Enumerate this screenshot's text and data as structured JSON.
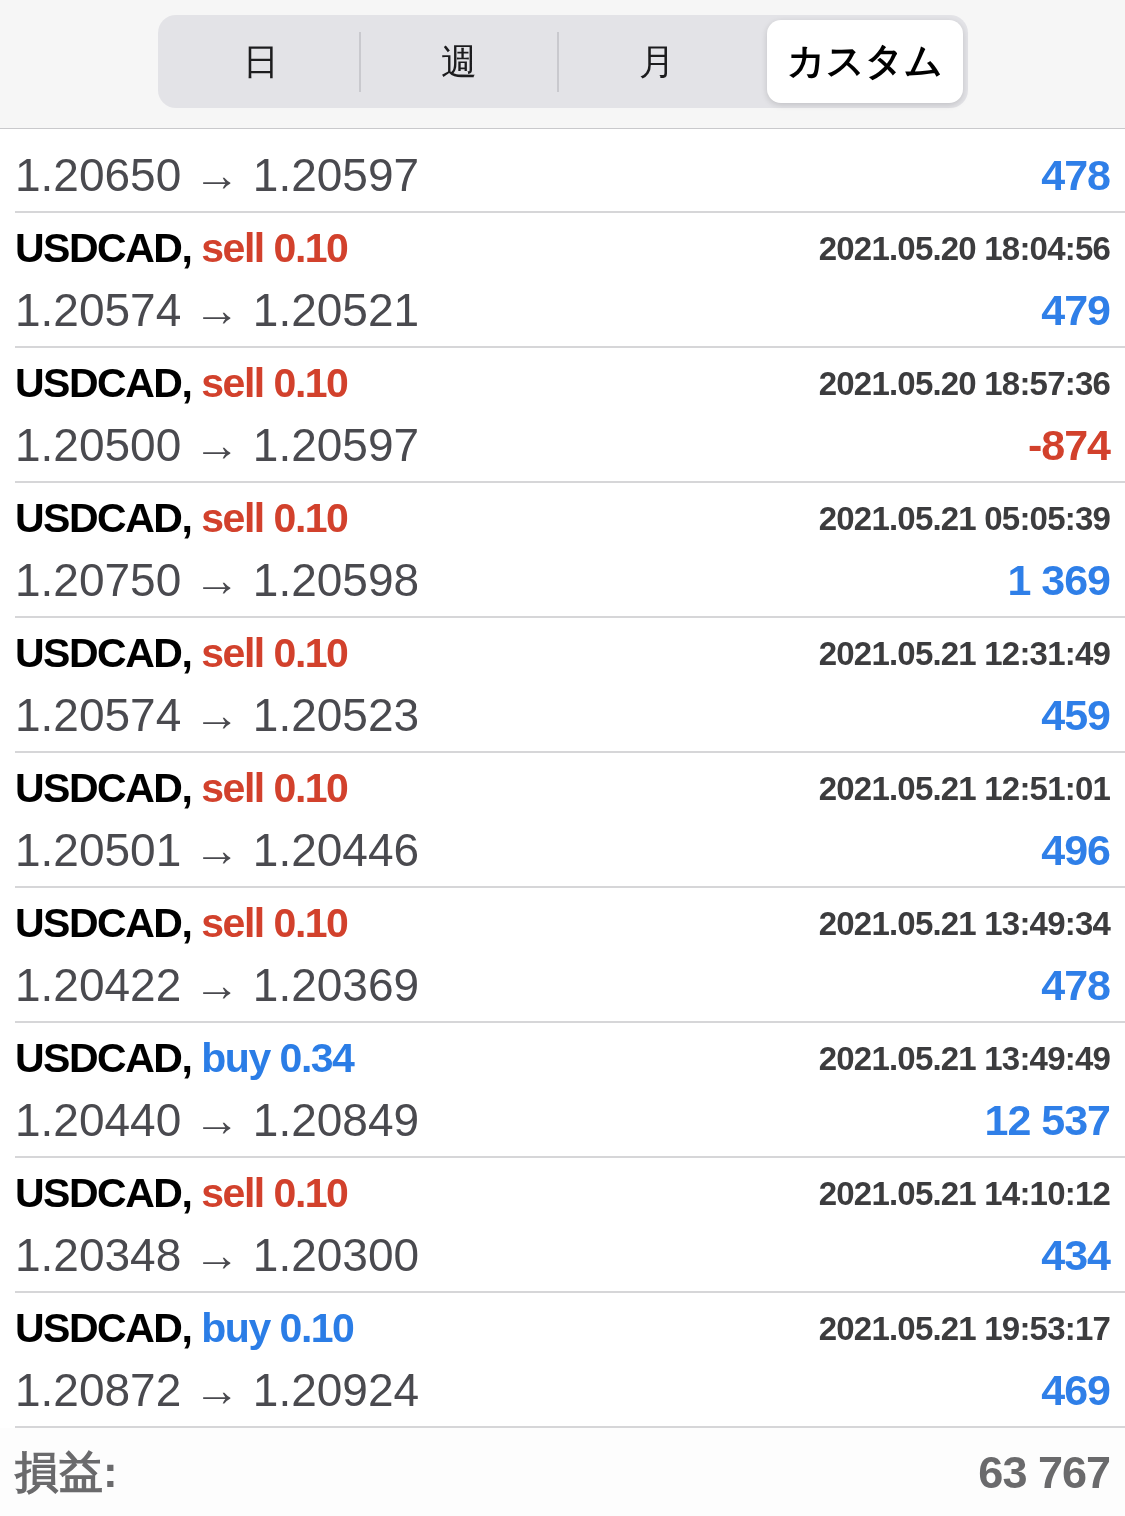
{
  "segmented_control": {
    "segments": [
      {
        "label": "日",
        "selected": false
      },
      {
        "label": "週",
        "selected": false
      },
      {
        "label": "月",
        "selected": false
      },
      {
        "label": "カスタム",
        "selected": true
      }
    ]
  },
  "trades": [
    {
      "prices": "1.20650 → 1.20597",
      "profit": "478",
      "loss": false
    },
    {
      "symbol": "USDCAD,",
      "order": "sell 0.10",
      "buy": false,
      "time": "2021.05.20 18:04:56",
      "prices": "1.20574 → 1.20521",
      "profit": "479",
      "loss": false
    },
    {
      "symbol": "USDCAD,",
      "order": "sell 0.10",
      "buy": false,
      "time": "2021.05.20 18:57:36",
      "prices": "1.20500 → 1.20597",
      "profit": "-874",
      "loss": true
    },
    {
      "symbol": "USDCAD,",
      "order": "sell 0.10",
      "buy": false,
      "time": "2021.05.21 05:05:39",
      "prices": "1.20750 → 1.20598",
      "profit": "1 369",
      "loss": false
    },
    {
      "symbol": "USDCAD,",
      "order": "sell 0.10",
      "buy": false,
      "time": "2021.05.21 12:31:49",
      "prices": "1.20574 → 1.20523",
      "profit": "459",
      "loss": false
    },
    {
      "symbol": "USDCAD,",
      "order": "sell 0.10",
      "buy": false,
      "time": "2021.05.21 12:51:01",
      "prices": "1.20501 → 1.20446",
      "profit": "496",
      "loss": false
    },
    {
      "symbol": "USDCAD,",
      "order": "sell 0.10",
      "buy": false,
      "time": "2021.05.21 13:49:34",
      "prices": "1.20422 → 1.20369",
      "profit": "478",
      "loss": false
    },
    {
      "symbol": "USDCAD,",
      "order": "buy 0.34",
      "buy": true,
      "time": "2021.05.21 13:49:49",
      "prices": "1.20440 → 1.20849",
      "profit": "12 537",
      "loss": false
    },
    {
      "symbol": "USDCAD,",
      "order": "sell 0.10",
      "buy": false,
      "time": "2021.05.21 14:10:12",
      "prices": "1.20348 → 1.20300",
      "profit": "434",
      "loss": false
    },
    {
      "symbol": "USDCAD,",
      "order": "buy 0.10",
      "buy": true,
      "time": "2021.05.21 19:53:17",
      "prices": "1.20872 → 1.20924",
      "profit": "469",
      "loss": false
    }
  ],
  "summary": {
    "label": "損益:",
    "value": "63 767"
  }
}
